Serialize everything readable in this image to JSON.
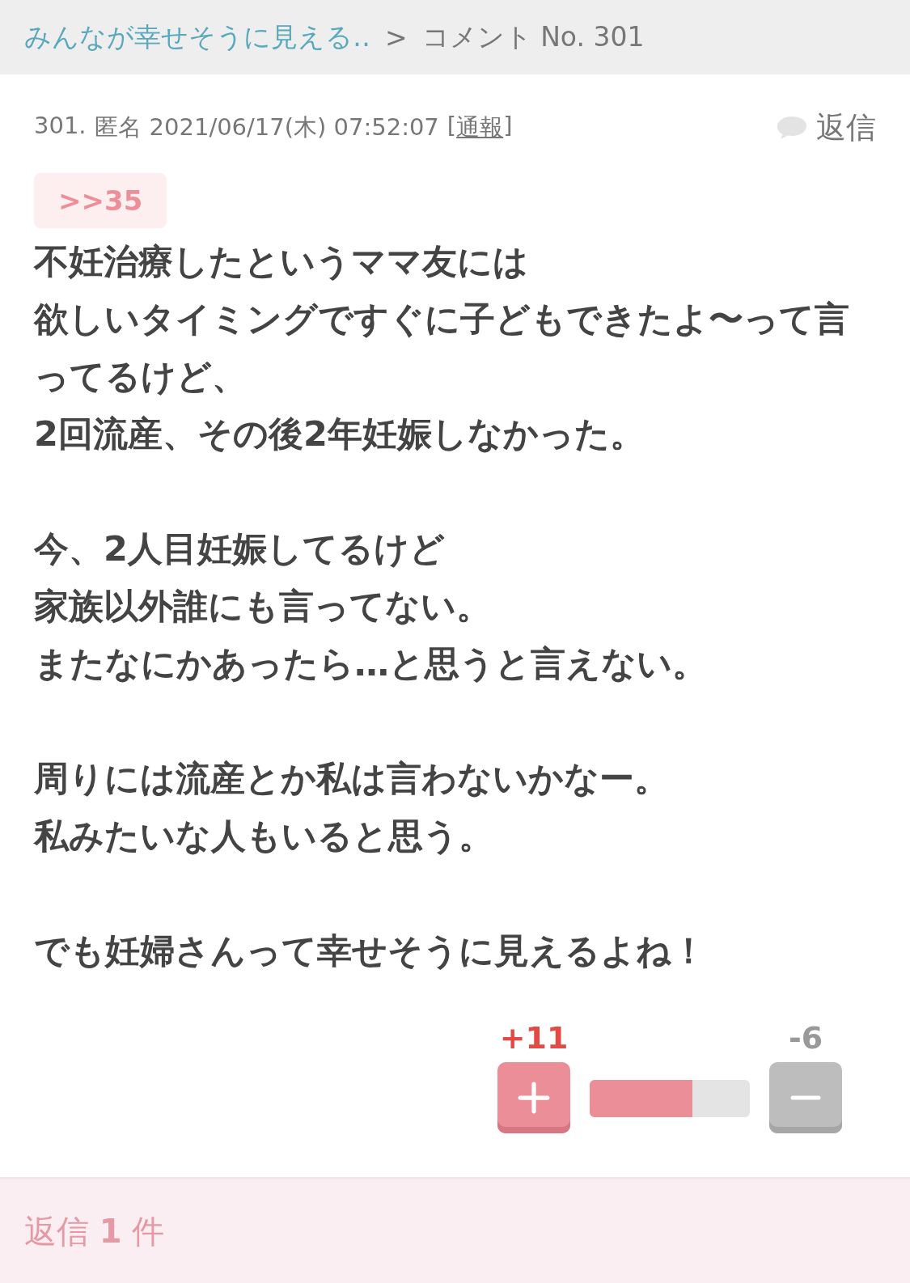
{
  "breadcrumb": {
    "parent": "みんなが幸せそうに見える‥",
    "separator": ">",
    "current": "コメント No. 301"
  },
  "comment": {
    "number": "301.",
    "author": "匿名",
    "date": "2021/06/17(木) 07:52:07",
    "report_open": "[",
    "report_link": "通報",
    "report_close": "]",
    "reply_button": "返信",
    "anchor": ">>35",
    "paragraphs": [
      [
        "不妊治療したというママ友には",
        "欲しいタイミングですぐに子どもできたよ〜って言ってるけど、",
        "2回流産、その後2年妊娠しなかった。"
      ],
      [
        "今、2人目妊娠してるけど",
        "家族以外誰にも言ってない。",
        "またなにかあったら…と思うと言えない。"
      ],
      [
        "周りには流産とか私は言わないかなー。",
        "私みたいな人もいると思う。"
      ],
      [
        "でも妊婦さんって幸せそうに見えるよね！"
      ]
    ]
  },
  "votes": {
    "plus": "+11",
    "minus": "-6",
    "level": 0.64
  },
  "replies": {
    "label": "返信 **1** 件"
  }
}
